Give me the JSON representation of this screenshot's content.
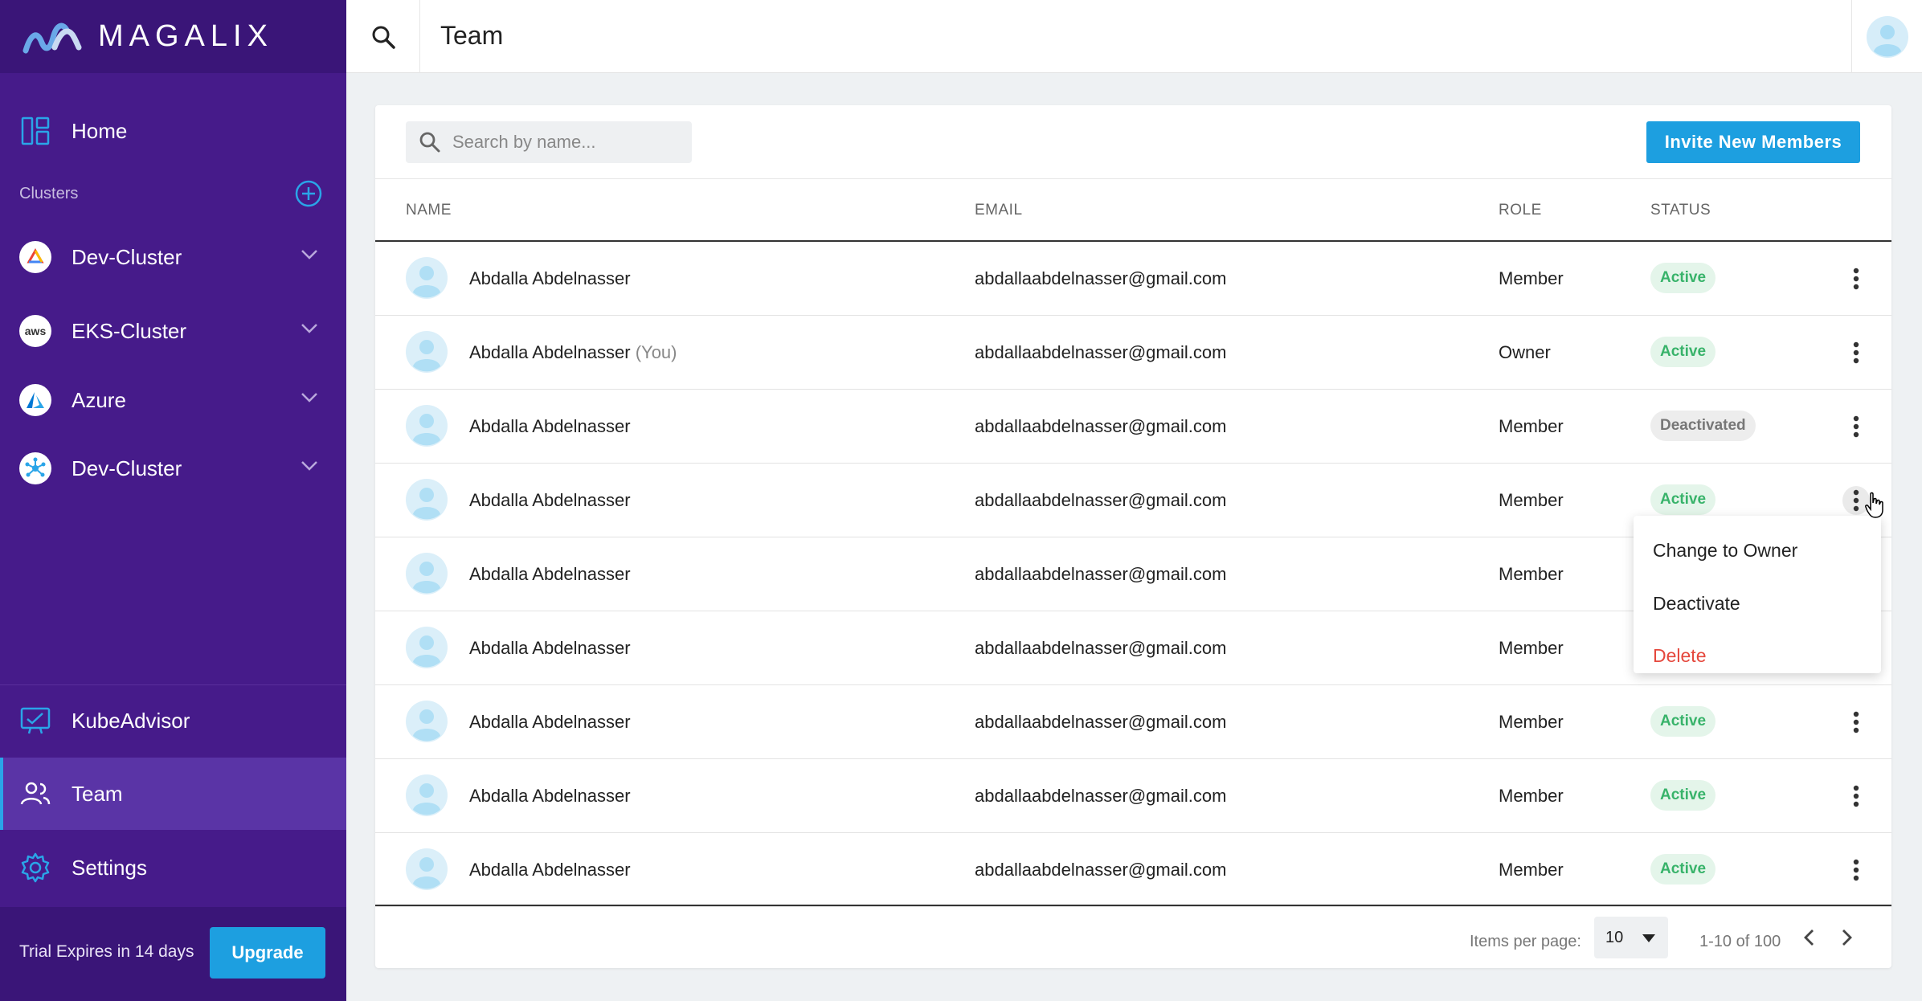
{
  "brand": {
    "name": "MAGALIX"
  },
  "sidebar": {
    "home_label": "Home",
    "clusters_label": "Clusters",
    "clusters": [
      {
        "label": "Dev-Cluster",
        "icon": "gcp-icon"
      },
      {
        "label": "EKS-Cluster",
        "icon": "aws-icon",
        "icon_text": "aws"
      },
      {
        "label": "Azure",
        "icon": "azure-icon"
      },
      {
        "label": "Dev-Cluster",
        "icon": "kubernetes-icon"
      }
    ],
    "kubeadvisor_label": "KubeAdvisor",
    "team_label": "Team",
    "settings_label": "Settings",
    "trial_text": "Trial Expires in 14 days",
    "upgrade_label": "Upgrade"
  },
  "topbar": {
    "title": "Team"
  },
  "toolbar": {
    "search_placeholder": "Search by name...",
    "invite_label": "Invite New Members"
  },
  "table": {
    "headers": {
      "name": "NAME",
      "email": "EMAIL",
      "role": "ROLE",
      "status": "STATUS"
    },
    "rows": [
      {
        "name": "Abdalla Abdelnasser",
        "suffix": "",
        "email": "abdallaabdelnasser@gmail.com",
        "role": "Member",
        "status": "Active"
      },
      {
        "name": "Abdalla Abdelnasser",
        "suffix": "(You)",
        "email": "abdallaabdelnasser@gmail.com",
        "role": "Owner",
        "status": "Active"
      },
      {
        "name": "Abdalla Abdelnasser",
        "suffix": "",
        "email": "abdallaabdelnasser@gmail.com",
        "role": "Member",
        "status": "Deactivated"
      },
      {
        "name": "Abdalla Abdelnasser",
        "suffix": "",
        "email": "abdallaabdelnasser@gmail.com",
        "role": "Member",
        "status": "Active"
      },
      {
        "name": "Abdalla Abdelnasser",
        "suffix": "",
        "email": "abdallaabdelnasser@gmail.com",
        "role": "Member",
        "status": ""
      },
      {
        "name": "Abdalla Abdelnasser",
        "suffix": "",
        "email": "abdallaabdelnasser@gmail.com",
        "role": "Member",
        "status": ""
      },
      {
        "name": "Abdalla Abdelnasser",
        "suffix": "",
        "email": "abdallaabdelnasser@gmail.com",
        "role": "Member",
        "status": "Active"
      },
      {
        "name": "Abdalla Abdelnasser",
        "suffix": "",
        "email": "abdallaabdelnasser@gmail.com",
        "role": "Member",
        "status": "Active"
      },
      {
        "name": "Abdalla Abdelnasser",
        "suffix": "",
        "email": "abdallaabdelnasser@gmail.com",
        "role": "Member",
        "status": "Active"
      }
    ]
  },
  "row_menu": {
    "items": [
      "Change to Owner",
      "Deactivate",
      "Delete"
    ]
  },
  "pagination": {
    "items_per_page_label": "Items per page:",
    "per_page_value": "10",
    "range": "1-10 of 100"
  },
  "colors": {
    "sidebar": "#461b8a",
    "accent": "#1d9fe0",
    "active_status": "#38b36a",
    "danger": "#e5483d"
  }
}
